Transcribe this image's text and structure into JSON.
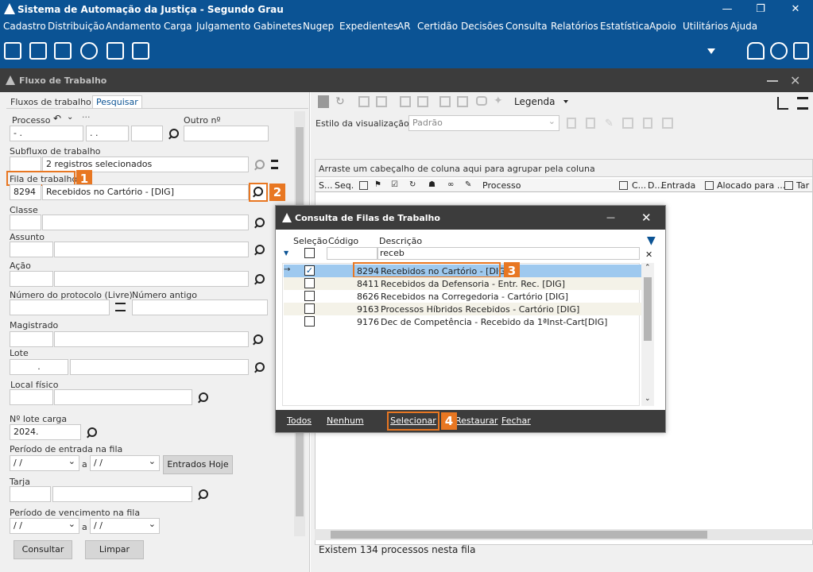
{
  "window": {
    "title": "Sistema de Automação da Justiça - Segundo Grau",
    "min": "—",
    "max": "❐",
    "close": "✕"
  },
  "menu": [
    "Cadastro",
    "Distribuição",
    "Andamento",
    "Carga",
    "Julgamento",
    "Gabinetes",
    "Nugep",
    "Expedientes",
    "AR",
    "Certidão",
    "Decisões",
    "Consulta",
    "Relatórios",
    "Estatística",
    "Apoio",
    "Utilitários",
    "Ajuda"
  ],
  "panel": {
    "title": "Fluxo de Trabalho",
    "close": "✕"
  },
  "tabs": [
    "Fluxos de trabalho",
    "Pesquisar"
  ],
  "form": {
    "processo_label": "Processo",
    "processo_part1": "- .",
    "processo_part2": ". .",
    "outro_label": "Outro nº",
    "subfluxo_label": "Subfluxo de trabalho",
    "subfluxo_value": "2 registros selecionados",
    "fila_label": "Fila de trabalho",
    "fila_code": "8294",
    "fila_value": "Recebidos no Cartório - [DIG]",
    "classe_label": "Classe",
    "assunto_label": "Assunto",
    "acao_label": "Ação",
    "protocolo_label": "Número do protocolo (Livre)",
    "antigo_label": "Número antigo",
    "magistrado_label": "Magistrado",
    "lote_label": "Lote",
    "lote_value": ".",
    "local_label": "Local físico",
    "nlote_label": "Nº lote carga",
    "nlote_value": "2024.",
    "periodo_entrada_label": "Período de entrada na fila",
    "date_placeholder": "/ /",
    "a_label": "a",
    "entradas_hoje": "Entrados Hoje",
    "tarja_label": "Tarja",
    "periodo_venc_label": "Período de vencimento na fila",
    "consultar": "Consultar",
    "limpar": "Limpar"
  },
  "right": {
    "legenda": "Legenda",
    "estilo_label": "Estilo da visualização",
    "estilo_value": "Padrão",
    "group_hint": "Arraste um cabeçalho de coluna aqui para agrupar pela coluna",
    "cols": [
      "S...",
      "Seq.",
      "Processo",
      "C...",
      "D...",
      "Entrada",
      "Alocado para ...",
      "Tar"
    ],
    "status": "Existem 134 processos nesta fila"
  },
  "dialog": {
    "title": "Consulta de Filas de Trabalho",
    "min": "—",
    "close": "✕",
    "col_selecao": "Seleção",
    "col_codigo": "Código",
    "col_descricao": "Descrição",
    "filter_value": "receb",
    "rows": [
      {
        "code": "8294",
        "desc": "Recebidos no Cartório - [DIG]",
        "checked": true
      },
      {
        "code": "8411",
        "desc": "Recebidos da Defensoria - Entr. Rec. [DIG]",
        "checked": false
      },
      {
        "code": "8626",
        "desc": "Recebidos na Corregedoria - Cartório [DIG]",
        "checked": false
      },
      {
        "code": "9163",
        "desc": "Processos Híbridos Recebidos - Cartório [DIG]",
        "checked": false
      },
      {
        "code": "9176",
        "desc": "Dec de Competência - Recebido da 1ªInst-Cart[DIG]",
        "checked": false
      }
    ],
    "buttons": {
      "todos": "Todos",
      "nenhum": "Nenhum",
      "selecionar": "Selecionar",
      "restaurar": "Restaurar",
      "fechar": "Fechar"
    }
  },
  "steps": [
    "1",
    "2",
    "3",
    "4"
  ],
  "colors": {
    "primary": "#0b5394",
    "accent": "#e87722",
    "selected_row": "#9ec9ef"
  }
}
